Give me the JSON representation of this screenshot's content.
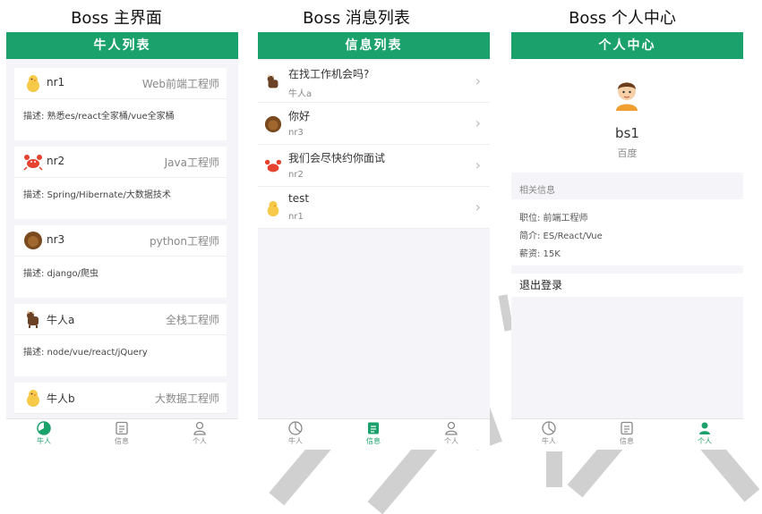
{
  "captions": {
    "main": "Boss 主界面",
    "messages": "Boss 消息列表",
    "profile": "Boss 个人中心"
  },
  "main_screen": {
    "title": "牛人列表",
    "cards": [
      {
        "name": "nr1",
        "job": "Web前端工程师",
        "desc": "描述: 熟悉es/react全家桶/vue全家桶",
        "avatar_icon": "chick-icon"
      },
      {
        "name": "nr2",
        "job": "Java工程师",
        "desc": "描述: Spring/Hibernate/大数据技术",
        "avatar_icon": "crab-icon"
      },
      {
        "name": "nr3",
        "job": "python工程师",
        "desc": "描述: django/爬虫",
        "avatar_icon": "brown-ball-icon"
      },
      {
        "name": "牛人a",
        "job": "全栈工程师",
        "desc": "描述: node/vue/react/jQuery",
        "avatar_icon": "cow-icon"
      },
      {
        "name": "牛人b",
        "job": "大数据工程师",
        "desc": "",
        "avatar_icon": "chick-icon"
      }
    ]
  },
  "messages_screen": {
    "title": "信息列表",
    "items": [
      {
        "text": "在找工作机会吗?",
        "from": "牛人a",
        "avatar_icon": "cow-icon"
      },
      {
        "text": "你好",
        "from": "nr3",
        "avatar_icon": "brown-ball-icon"
      },
      {
        "text": "我们会尽快约你面试",
        "from": "nr2",
        "avatar_icon": "crab-icon"
      },
      {
        "text": "test",
        "from": "nr1",
        "avatar_icon": "chick-icon"
      }
    ],
    "arrow": "›"
  },
  "profile_screen": {
    "title": "个人中心",
    "avatar_icon": "boy-avatar-icon",
    "username": "bs1",
    "company": "百度",
    "section_header": "相关信息",
    "info": [
      "职位: 前端工程师",
      "简介: ES/React/Vue",
      "薪资: 15K"
    ],
    "logout": "退出登录"
  },
  "tabbar": {
    "tabs": [
      {
        "label": "牛人",
        "icon": "pie-chart-icon"
      },
      {
        "label": "信息",
        "icon": "message-list-icon"
      },
      {
        "label": "个人",
        "icon": "user-icon"
      }
    ]
  },
  "colors": {
    "brand_green": "#1ba26c",
    "page_gray": "#f5f5f9"
  }
}
